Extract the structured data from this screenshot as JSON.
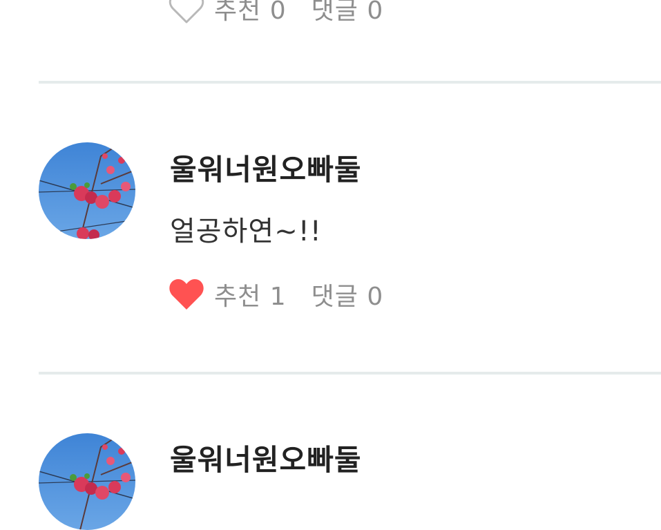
{
  "colors": {
    "liked_heart": "#ff5252",
    "outline_heart": "#b8b8b8",
    "muted_text": "#8e8e8e",
    "author_text": "#222222",
    "divider": "#e5ebeb",
    "avatar_sky": "#4f8fd8",
    "avatar_blossom": "#d93a5a"
  },
  "comments": [
    {
      "like_icon": "heart-outline-icon",
      "like_label": "추천",
      "like_count": "0",
      "reply_label": "댓글",
      "reply_count": "0"
    },
    {
      "author": "울워너원오빠둘",
      "avatar_icon": "blossom-avatar",
      "text": "얼공하연~!!",
      "like_icon": "heart-filled-icon",
      "like_label": "추천",
      "like_count": "1",
      "reply_label": "댓글",
      "reply_count": "0"
    },
    {
      "author": "울워너원오빠둘",
      "avatar_icon": "blossom-avatar"
    }
  ]
}
